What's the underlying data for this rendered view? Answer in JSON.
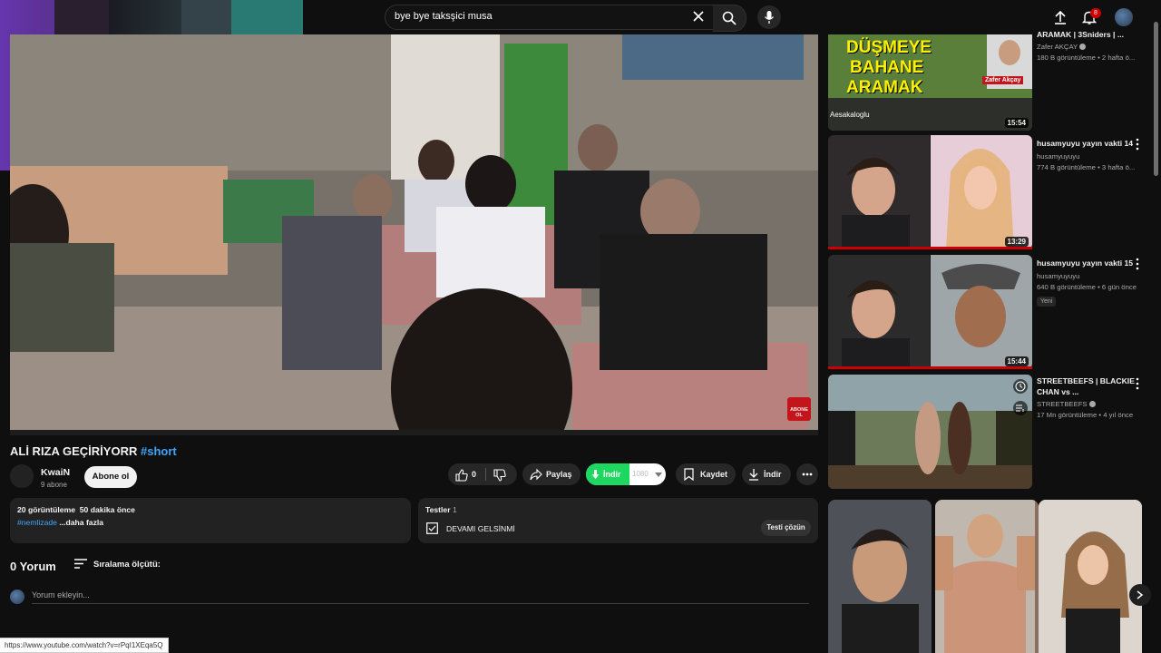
{
  "search": {
    "query": "bye bye taksşici musa"
  },
  "header": {
    "notification_count": "8"
  },
  "video": {
    "title": "ALİ RIZA GEÇİRİYORR",
    "hashtag": "#short",
    "channel": "KwaiN",
    "subscribers": "9 abone",
    "subscribe_label": "Abone ol",
    "likes": "0",
    "share_label": "Paylaş",
    "download_label": "İndir",
    "quality": "1080",
    "save_label": "Kaydet",
    "download2_label": "İndir"
  },
  "description": {
    "stats": "20 görüntüleme  50 dakika önce",
    "tag": "#nemlizade",
    "more": " ...daha fazla"
  },
  "quiz": {
    "title": "Testler",
    "count": "1",
    "item": "DEVAMI GELSİNMİ",
    "solve_label": "Testi çözün"
  },
  "comments": {
    "count": "0 Yorum",
    "sort_label": "Sıralama ölçütü:",
    "placeholder": "Yorum ekleyin..."
  },
  "status_url": "https://www.youtube.com/watch?v=rPqI1XEqa5Q",
  "sidebar": [
    {
      "title": "ARAMAK | 3Sniders | ...",
      "channel": "Zafer AKÇAY",
      "meta": "180 B görüntüleme • 2 hafta ö...",
      "duration": "15:54",
      "thumb_text": [
        "DÜŞMEYE",
        "BAHANE",
        "ARAMAK"
      ],
      "thumb_name": "Zafer Akçay",
      "thumb_author": "Aesakaloglu"
    },
    {
      "title": "husamyuyu yayın vakti 14",
      "channel": "husamyuyuyu",
      "meta": "774 B görüntüleme • 3 hafta ö...",
      "duration": "13:29"
    },
    {
      "title": "husamyuyu yayın vakti 15",
      "channel": "husamyuyuyu",
      "meta": "640 B görüntüleme • 6 gün önce",
      "badge": "Yeni",
      "duration": "15:44"
    },
    {
      "title": "STREETBEEFS | BLACKIE CHAN vs ...",
      "channel": "STREETBEEFS",
      "meta": "17 Mn görüntüleme • 4 yıl önce"
    }
  ],
  "player_badge": {
    "line1": "ABONE",
    "line2": "OL"
  },
  "colors": {
    "accent_blue": "#3ea6ff",
    "download_green": "#1ed760",
    "notification_red": "#cc0000",
    "progress_red": "#cc0000"
  }
}
